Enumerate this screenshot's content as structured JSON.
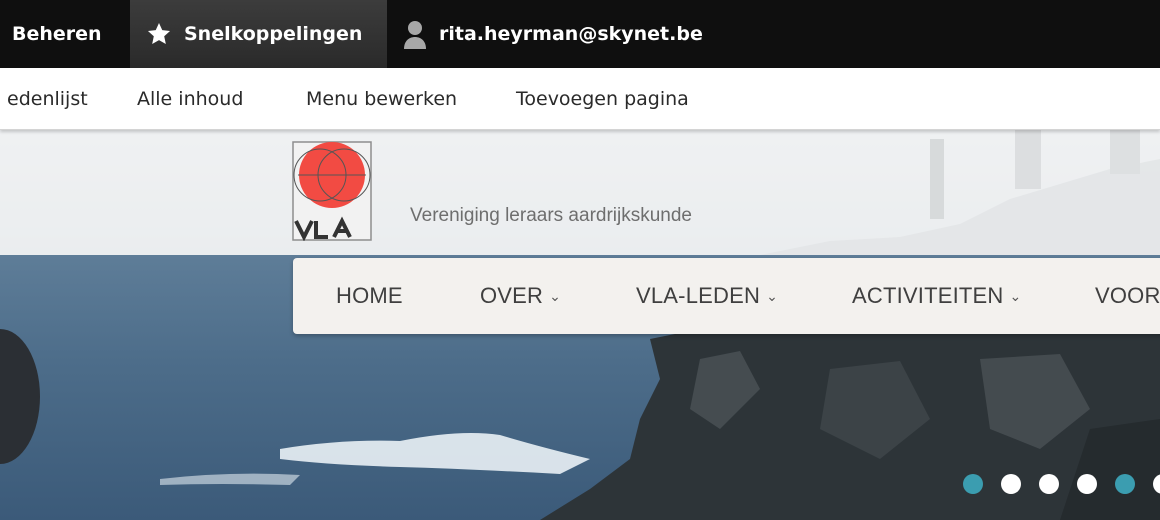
{
  "toolbar": {
    "beheren": "Beheren",
    "shortcuts": "Snelkoppelingen",
    "user": "rita.heyrman@skynet.be",
    "icons": {
      "shortcuts": "star-icon",
      "user": "user-icon"
    }
  },
  "tray": {
    "items": [
      {
        "label": "edenlijst"
      },
      {
        "label": "Alle inhoud"
      },
      {
        "label": "Menu bewerken"
      },
      {
        "label": "Toevoegen pagina"
      }
    ]
  },
  "site": {
    "logo_text": "VLA",
    "slogan": "Vereniging leraars aardrijkskunde"
  },
  "nav": {
    "items": [
      {
        "label": "HOME",
        "dropdown": false
      },
      {
        "label": "OVER",
        "dropdown": true
      },
      {
        "label": "VLA-LEDEN",
        "dropdown": true
      },
      {
        "label": "ACTIVITEITEN",
        "dropdown": true
      },
      {
        "label": "VOOR",
        "dropdown": false
      }
    ],
    "chevron": "⌄"
  },
  "slider": {
    "dots": [
      "teal",
      "white",
      "white",
      "white",
      "teal",
      "white"
    ]
  },
  "colors": {
    "toolbar_bg": "#0f0f0f",
    "logo_red": "#f24b43",
    "accent_teal": "#3b9db0"
  }
}
